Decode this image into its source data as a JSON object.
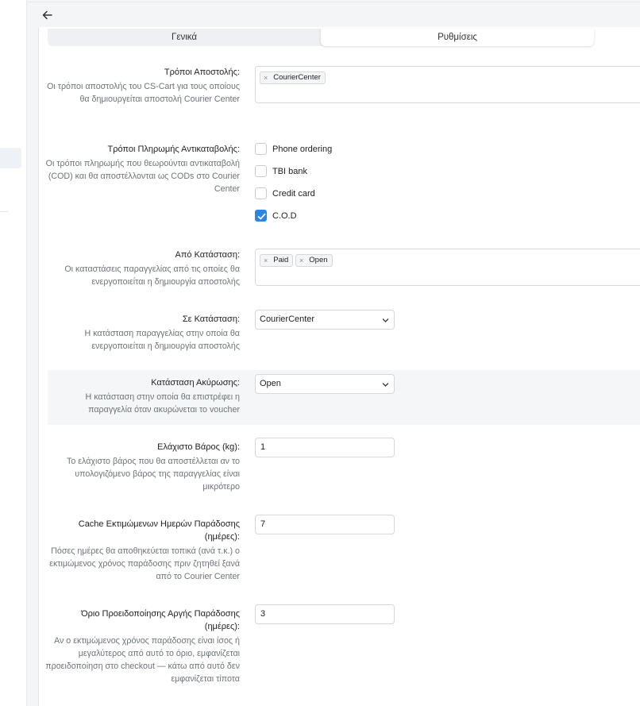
{
  "tabs": [
    {
      "label": "Γενικά",
      "active": false
    },
    {
      "label": "Ρυθμίσεις",
      "active": true
    }
  ],
  "fields": {
    "shipping_methods": {
      "title": "Τρόποι Αποστολής:",
      "description": "Οι τρόποι αποστολής του CS-Cart για τους οποίους θα δημιουργείται αποστολή Courier Center",
      "chips": [
        "CourierCenter"
      ]
    },
    "cod_payments": {
      "title": "Τρόποι Πληρωμής Αντικαταβολής:",
      "description": "Οι τρόποι πληρωμής που θεωρούνται αντικαταβολή (COD) και θα αποστέλλονται ως CODs στο Courier Center",
      "options": [
        {
          "label": "Phone ordering",
          "checked": false
        },
        {
          "label": "TBI bank",
          "checked": false
        },
        {
          "label": "Credit card",
          "checked": false
        },
        {
          "label": "C.O.D",
          "checked": true
        }
      ]
    },
    "from_status": {
      "title": "Από Κατάσταση:",
      "description": "Οι καταστάσεις παραγγελίας από τις οποίες θα ενεργοποιείται η δημιουργία αποστολής",
      "chips": [
        "Paid",
        "Open"
      ]
    },
    "to_status": {
      "title": "Σε Κατάσταση:",
      "description": "Η κατάσταση παραγγελίας στην οποία θα ενεργοποιείται η δημιουργία αποστολής",
      "value": "CourierCenter"
    },
    "cancel_status": {
      "title": "Κατάσταση Ακύρωσης:",
      "description": "Η κατάσταση στην οποία θα επιστρέφει η παραγγελία όταν ακυρώνεται το voucher",
      "value": "Open"
    },
    "min_weight": {
      "title": "Ελάχιστο Βάρος (kg):",
      "description": "Το ελάχιστο βάρος που θα αποστέλλεται αν το υπολογιζόμενο βάρος της παραγγελίας είναι μικρότερο",
      "value": "1"
    },
    "cache_days": {
      "title": "Cache Εκτιμώμενων Ημερών Παράδοσης (ημέρες):",
      "description": "Πόσες ημέρες θα αποθηκεύεται τοπικά (ανά τ.κ.) ο εκτιμώμενος χρόνος παράδοσης πριν ζητηθεί ξανά από το Courier Center",
      "value": "7"
    },
    "late_warning": {
      "title": "Όριο Προειδοποίησης Αργής Παράδοσης (ημέρες):",
      "description": "Αν ο εκτιμώμενος χρόνος παράδοσης είναι ίσος ή μεγαλύτερος από αυτό το όριο, εμφανίζεται προειδοποίηση στο checkout — κάτω από αυτό δεν εμφανίζεται τίποτα",
      "value": "3"
    }
  },
  "colors": {
    "accent": "#2b86e3",
    "page_bg": "#f4f5f7",
    "muted_text": "#6d737b"
  },
  "icons": {
    "back": "arrow-left-icon",
    "chip_remove": "×",
    "select": "chevron-down-icon"
  }
}
